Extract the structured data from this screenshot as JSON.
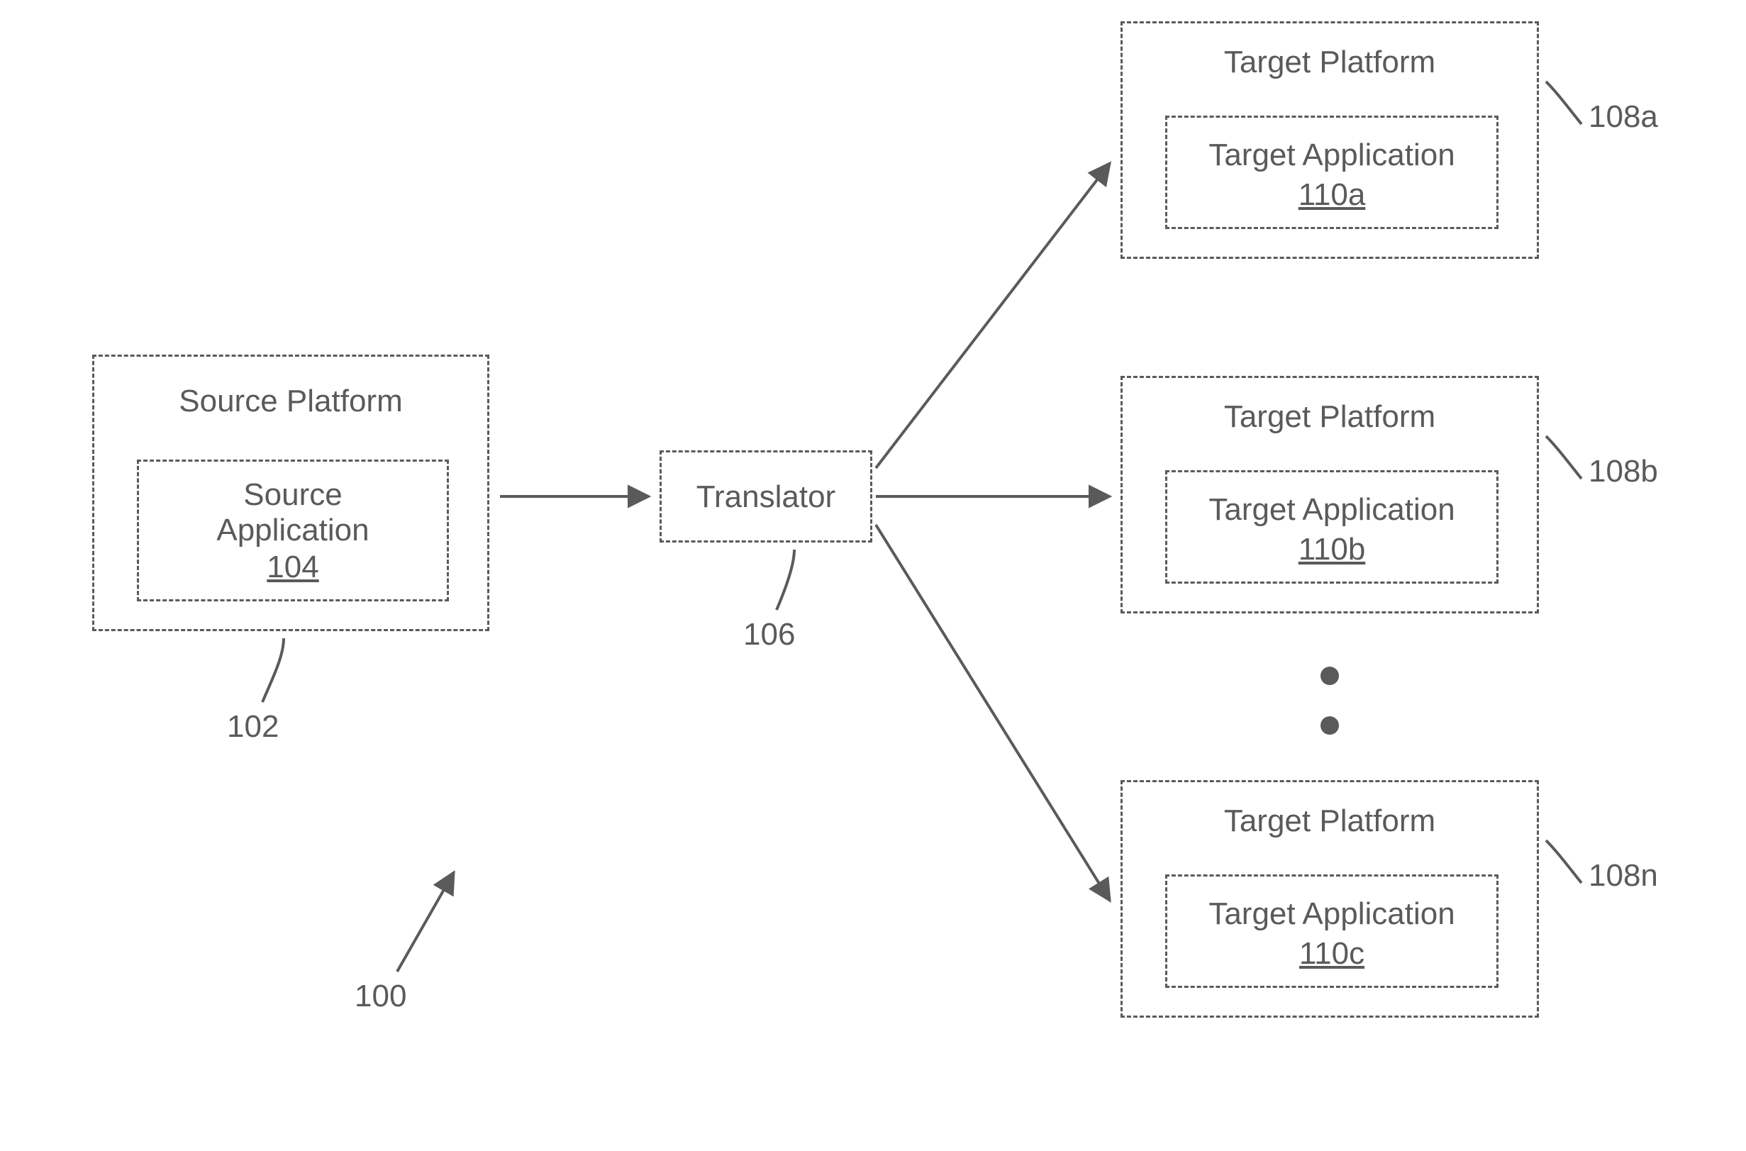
{
  "diagram": {
    "figure_ref": "100",
    "source_platform": {
      "title": "Source Platform",
      "ref": "102",
      "app": {
        "label_line1": "Source",
        "label_line2": "Application",
        "ref": "104"
      }
    },
    "translator": {
      "label": "Translator",
      "ref": "106"
    },
    "targets": [
      {
        "title": "Target Platform",
        "ref": "108a",
        "app_label": "Target Application",
        "app_ref": "110a"
      },
      {
        "title": "Target Platform",
        "ref": "108b",
        "app_label": "Target Application",
        "app_ref": "110b"
      },
      {
        "title": "Target Platform",
        "ref": "108n",
        "app_label": "Target Application",
        "app_ref": "110c"
      }
    ]
  }
}
